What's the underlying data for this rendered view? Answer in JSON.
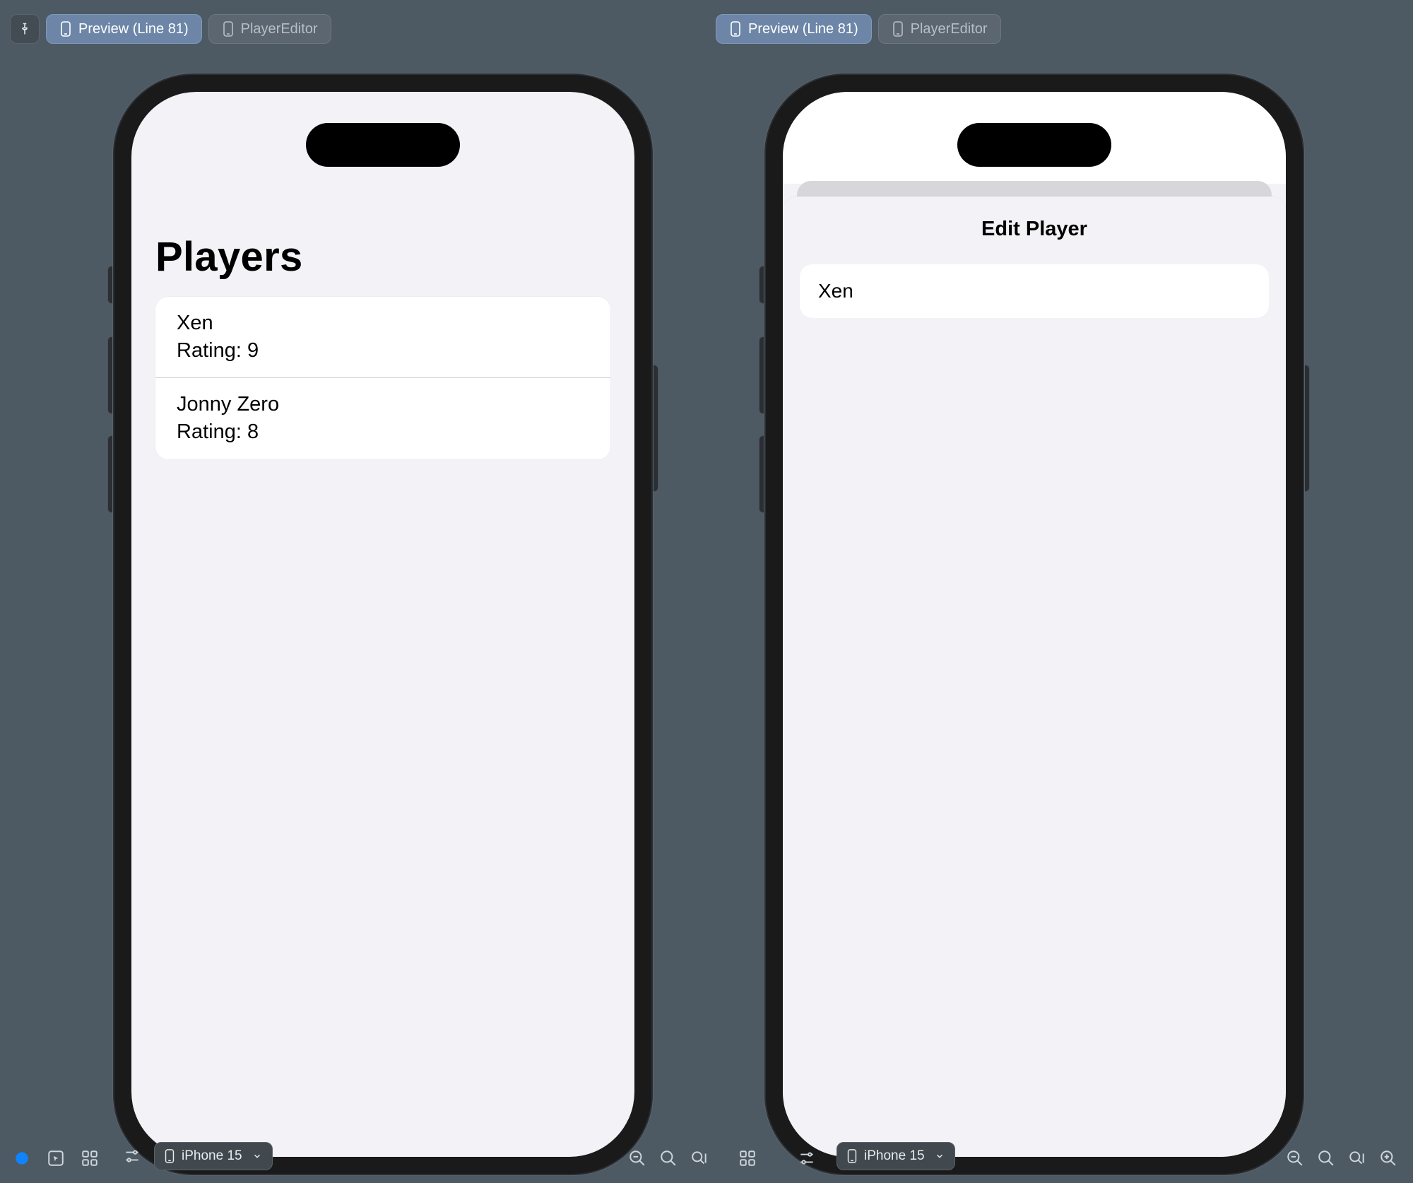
{
  "tabs": {
    "left": {
      "preview_label": "Preview (Line 81)",
      "editor_label": "PlayerEditor"
    },
    "right": {
      "preview_label": "Preview (Line 81)",
      "editor_label": "PlayerEditor"
    }
  },
  "preview_left": {
    "title": "Players",
    "rows": [
      {
        "name": "Xen",
        "rating_label": "Rating: 9"
      },
      {
        "name": "Jonny Zero",
        "rating_label": "Rating: 8"
      }
    ]
  },
  "preview_right": {
    "sheet_title": "Edit Player",
    "name_value": "Xen"
  },
  "device_picker": {
    "left_label": "iPhone 15",
    "right_label": "iPhone 15"
  }
}
